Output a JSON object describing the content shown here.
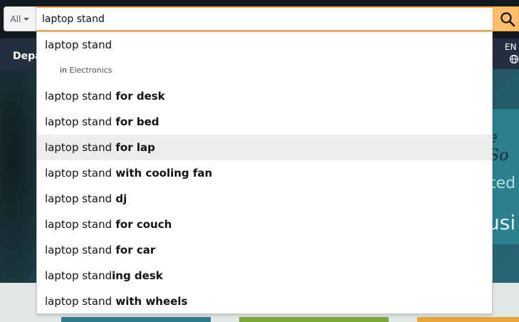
{
  "nav": {
    "departments_label": "Depa",
    "lang_label": "EN"
  },
  "hero": {
    "card_line1": "e So",
    "card_line2": "ted",
    "card_line3": "usi"
  },
  "search": {
    "category_label": "All",
    "query": "laptop stand"
  },
  "suggestions": {
    "first": "laptop stand",
    "scope_prefix": "in",
    "scope_department": "Electronics",
    "items": [
      {
        "prefix": "laptop stand",
        "suffix": " for desk"
      },
      {
        "prefix": "laptop stand",
        "suffix": " for bed"
      },
      {
        "prefix": "laptop stand",
        "suffix": " for lap",
        "highlighted": true
      },
      {
        "prefix": "laptop stand",
        "suffix": " with cooling fan"
      },
      {
        "prefix": "laptop stand",
        "suffix": " dj"
      },
      {
        "prefix": "laptop stand",
        "suffix": " for couch"
      },
      {
        "prefix": "laptop stand",
        "suffix": " for car"
      },
      {
        "prefix": "laptop stand",
        "suffix": "ing desk"
      },
      {
        "prefix": "laptop stand",
        "suffix": " with wheels"
      }
    ]
  },
  "colors": {
    "accent": "#febd69",
    "nav_bg": "#131921",
    "subnav_bg": "#232f3e",
    "highlight_row": "#ececec"
  }
}
